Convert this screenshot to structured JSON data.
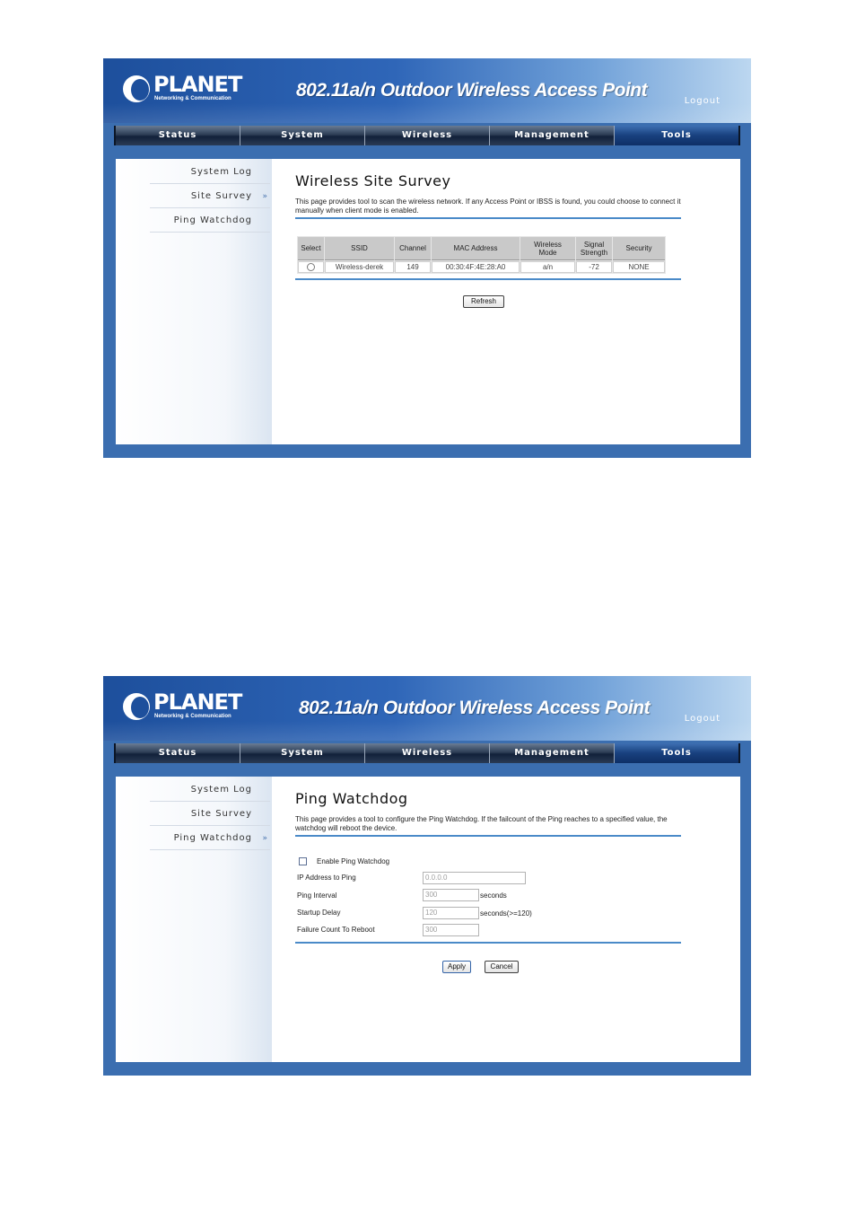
{
  "common": {
    "logo_word": "PLANET",
    "logo_sub": "Networking & Communication",
    "product_title": "802.11a/n Outdoor Wireless Access Point",
    "logout": "Logout",
    "nav": [
      "Status",
      "System",
      "Wireless",
      "Management",
      "Tools"
    ],
    "sidebar": [
      "System Log",
      "Site Survey",
      "Ping Watchdog"
    ],
    "arrow": "»",
    "colors": {
      "accent": "#4a8ac8",
      "frame": "#3b6eb0"
    }
  },
  "site_survey": {
    "title": "Wireless Site Survey",
    "description": "This page provides tool to scan the wireless network. If any Access Point or IBSS is found, you could choose to connect it manually when client mode is enabled.",
    "columns": {
      "select": "Select",
      "ssid": "SSID",
      "channel": "Channel",
      "mac": "MAC Address",
      "mode_1": "Wireless",
      "mode_2": "Mode",
      "signal_1": "Signal",
      "signal_2": "Strength",
      "security": "Security"
    },
    "rows": [
      {
        "ssid": "Wireless-derek",
        "channel": "149",
        "mac": "00:30:4F:4E:28:A0",
        "mode": "a/n",
        "signal": "-72",
        "security": "NONE"
      }
    ],
    "refresh_label": "Refresh"
  },
  "ping_watchdog": {
    "title": "Ping Watchdog",
    "description": "This page provides a tool to configure the Ping Watchdog. If the failcount of the Ping reaches to a specified value, the watchdog will reboot the device.",
    "enable_label": "Enable Ping Watchdog",
    "fields": {
      "ip": {
        "label": "IP Address to Ping",
        "value": "0.0.0.0"
      },
      "interval": {
        "label": "Ping Interval",
        "value": "300",
        "unit": "seconds"
      },
      "startup": {
        "label": "Startup Delay",
        "value": "120",
        "unit": "seconds(>=120)"
      },
      "failure": {
        "label": "Failure Count To Reboot",
        "value": "300"
      }
    },
    "apply_label": "Apply",
    "cancel_label": "Cancel"
  }
}
